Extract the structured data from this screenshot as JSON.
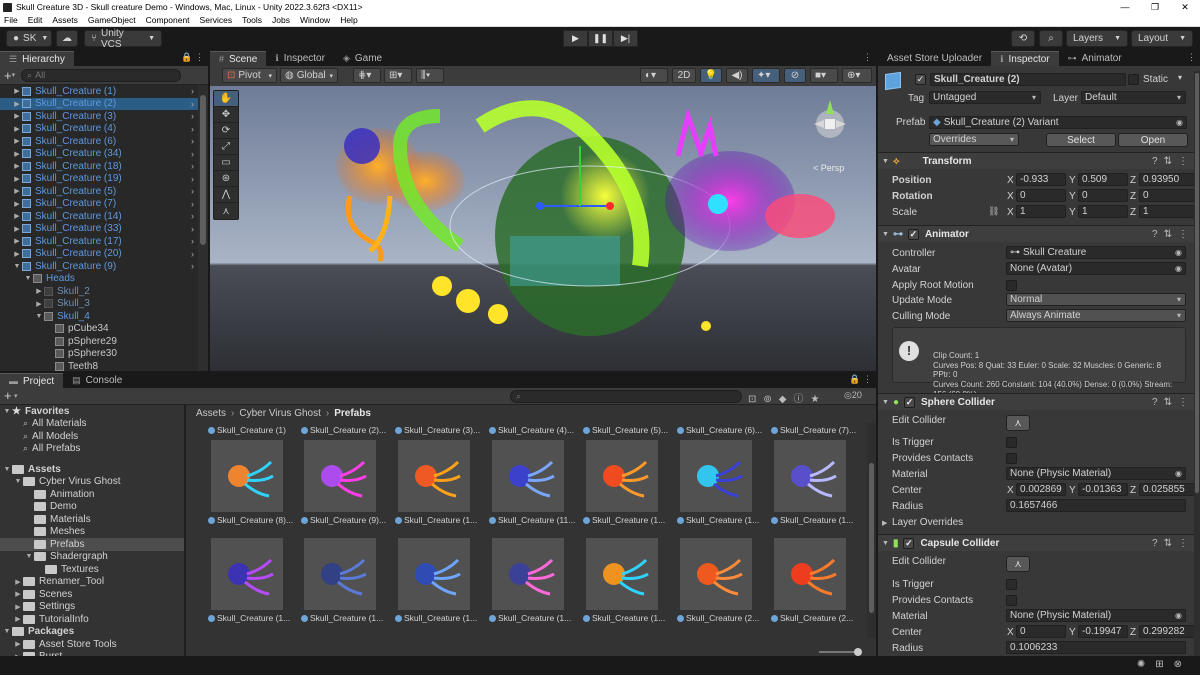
{
  "window": {
    "title": "Skull Creature 3D - Skull creature Demo - Windows, Mac, Linux - Unity 2022.3.62f3 <DX11>",
    "controls": [
      "—",
      "❐",
      "✕"
    ]
  },
  "menu": [
    "File",
    "Edit",
    "Assets",
    "GameObject",
    "Component",
    "Services",
    "Tools",
    "Jobs",
    "Window",
    "Help"
  ],
  "toolbar": {
    "account": "SK",
    "vcs": "Unity VCS",
    "layers": "Layers",
    "layout": "Layout"
  },
  "hierarchy": {
    "tab": "Hierarchy",
    "search_placeholder": "All",
    "items": [
      {
        "label": "Skull_Creature (1)",
        "type": "prefab"
      },
      {
        "label": "Skull_Creature (2)",
        "type": "prefab",
        "selected": true
      },
      {
        "label": "Skull_Creature (3)",
        "type": "prefab"
      },
      {
        "label": "Skull_Creature (4)",
        "type": "prefab"
      },
      {
        "label": "Skull_Creature (6)",
        "type": "prefab"
      },
      {
        "label": "Skull_Creature (34)",
        "type": "prefab"
      },
      {
        "label": "Skull_Creature (18)",
        "type": "prefab"
      },
      {
        "label": "Skull_Creature (19)",
        "type": "prefab"
      },
      {
        "label": "Skull_Creature (5)",
        "type": "prefab"
      },
      {
        "label": "Skull_Creature (7)",
        "type": "prefab"
      },
      {
        "label": "Skull_Creature (14)",
        "type": "prefab"
      },
      {
        "label": "Skull_Creature (33)",
        "type": "prefab"
      },
      {
        "label": "Skull_Creature (17)",
        "type": "prefab"
      },
      {
        "label": "Skull_Creature (20)",
        "type": "prefab"
      },
      {
        "label": "Skull_Creature (9)",
        "type": "prefab",
        "expanded": true
      },
      {
        "label": "Heads",
        "indent": 1,
        "expanded": true
      },
      {
        "label": "Skull_2",
        "indent": 2,
        "dim": true
      },
      {
        "label": "Skull_3",
        "indent": 2,
        "dim": true
      },
      {
        "label": "Skull_4",
        "indent": 2,
        "expanded": true
      },
      {
        "label": "pCube34",
        "indent": 3
      },
      {
        "label": "pSphere29",
        "indent": 3
      },
      {
        "label": "pSphere30",
        "indent": 3
      },
      {
        "label": "Teeth8",
        "indent": 3
      }
    ]
  },
  "scene": {
    "tabs": [
      "Scene",
      "Inspector",
      "Game"
    ],
    "pivot": "Pivot",
    "global": "Global",
    "mode_2d": "2D",
    "persp": "< Persp"
  },
  "inspector": {
    "tabs": [
      "Asset Store Uploader",
      "Inspector",
      "Animator"
    ],
    "object_name": "Skull_Creature (2)",
    "static_label": "Static",
    "tag_label": "Tag",
    "tag": "Untagged",
    "layer_label": "Layer",
    "layer": "Default",
    "prefab_label": "Prefab",
    "prefab": "Skull_Creature (2) Variant",
    "overrides": "Overrides",
    "select": "Select",
    "open": "Open",
    "transform": {
      "title": "Transform",
      "position_label": "Position",
      "rotation_label": "Rotation",
      "scale_label": "Scale",
      "position": [
        "-0.933",
        "0.509",
        "0.93950"
      ],
      "rotation": [
        "0",
        "0",
        "0"
      ],
      "scale": [
        "1",
        "1",
        "1"
      ]
    },
    "animator": {
      "title": "Animator",
      "controller_label": "Controller",
      "controller": "Skull Creature",
      "avatar_label": "Avatar",
      "avatar": "None (Avatar)",
      "root_motion_label": "Apply Root Motion",
      "update_mode_label": "Update Mode",
      "update_mode": "Normal",
      "culling_mode_label": "Culling Mode",
      "culling_mode": "Always Animate",
      "info": "Clip Count: 1\nCurves Pos: 8 Quat: 33 Euler: 0 Scale: 32 Muscles: 0 Generic: 8 PPtr: 0\nCurves Count: 260 Constant: 104 (40.0%) Dense: 0 (0.0%) Stream: 156 (60.0%)"
    },
    "sphere_collider": {
      "title": "Sphere Collider",
      "edit_label": "Edit Collider",
      "trigger_label": "Is Trigger",
      "contacts_label": "Provides Contacts",
      "material_label": "Material",
      "material": "None (Physic Material)",
      "center_label": "Center",
      "center": [
        "0.002869",
        "-0.01363",
        "0.025855"
      ],
      "radius_label": "Radius",
      "radius": "0.1657466",
      "layer_overrides": "Layer Overrides"
    },
    "capsule_collider": {
      "title": "Capsule Collider",
      "edit_label": "Edit Collider",
      "trigger_label": "Is Trigger",
      "contacts_label": "Provides Contacts",
      "material_label": "Material",
      "material": "None (Physic Material)",
      "center_label": "Center",
      "center": [
        "0",
        "-0.19947",
        "0.299282"
      ],
      "radius_label": "Radius",
      "radius": "0.1006233"
    }
  },
  "project": {
    "tabs": [
      "Project",
      "Console"
    ],
    "favorites": [
      "Favorites",
      "All Materials",
      "All Models",
      "All Prefabs"
    ],
    "assets_root": "Assets",
    "folders": [
      {
        "label": "Cyber Virus Ghost",
        "indent": 1,
        "expanded": true
      },
      {
        "label": "Animation",
        "indent": 2
      },
      {
        "label": "Demo",
        "indent": 2
      },
      {
        "label": "Materials",
        "indent": 2
      },
      {
        "label": "Meshes",
        "indent": 2
      },
      {
        "label": "Prefabs",
        "indent": 2,
        "selected": true
      },
      {
        "label": "Shadergraph",
        "indent": 2,
        "expanded": true
      },
      {
        "label": "Textures",
        "indent": 3
      },
      {
        "label": "Renamer_Tool",
        "indent": 1
      },
      {
        "label": "Scenes",
        "indent": 1
      },
      {
        "label": "Settings",
        "indent": 1
      },
      {
        "label": "TutorialInfo",
        "indent": 1
      }
    ],
    "packages_root": "Packages",
    "packages": [
      {
        "label": "Asset Store Tools",
        "indent": 1
      },
      {
        "label": "Burst",
        "indent": 1
      }
    ],
    "breadcrumb": [
      "Assets",
      "Cyber Virus Ghost",
      "Prefabs"
    ],
    "hidden_count": "20",
    "top_row": [
      "Skull_Creature (1)",
      "Skull_Creature (2)...",
      "Skull_Creature (3)...",
      "Skull_Creature (4)...",
      "Skull_Creature (5)...",
      "Skull_Creature (6)...",
      "Skull_Creature (7)..."
    ],
    "row1": [
      "Skull_Creature (8)...",
      "Skull_Creature (9)...",
      "Skull_Creature (1...",
      "Skull_Creature (11...",
      "Skull_Creature (1...",
      "Skull_Creature (1...",
      "Skull_Creature (1..."
    ],
    "row2": [
      "Skull_Creature (1...",
      "Skull_Creature (1...",
      "Skull_Creature (1...",
      "Skull_Creature (1...",
      "Skull_Creature (1...",
      "Skull_Creature (2...",
      "Skull_Creature (2..."
    ]
  }
}
